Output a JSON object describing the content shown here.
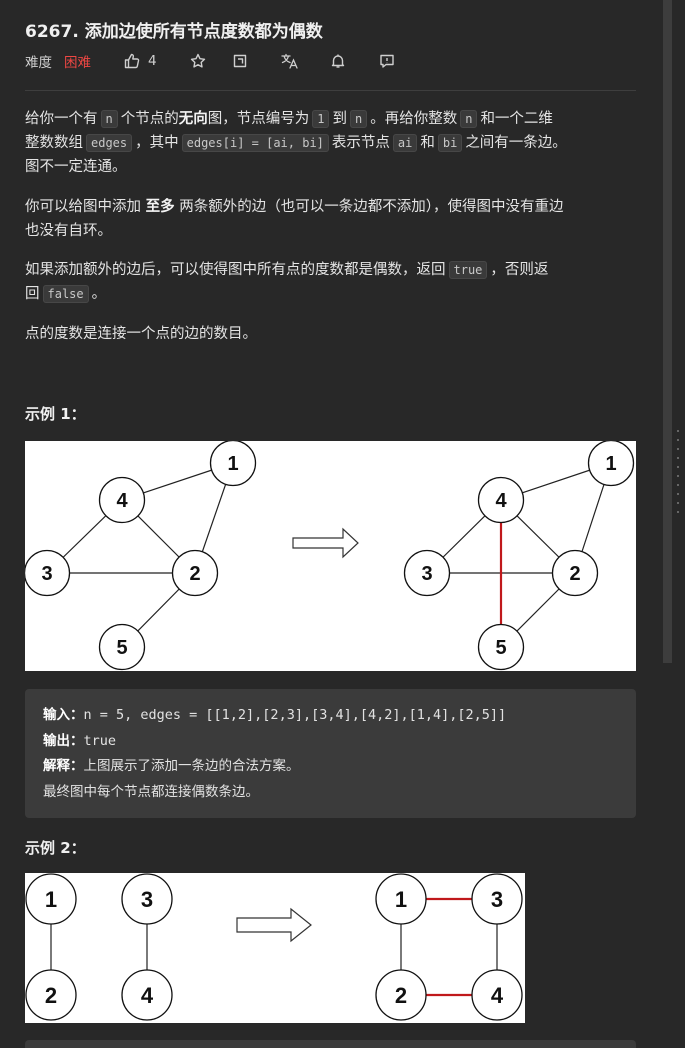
{
  "problem": {
    "title": "6267. 添加边使所有节点度数都为偶数",
    "difficulty_label": "难度",
    "difficulty": "困难",
    "likes": "4",
    "icons": [
      "thumb-up-icon",
      "star-icon",
      "share-icon",
      "translate-icon",
      "bell-icon",
      "feedback-icon"
    ]
  },
  "description": {
    "p1": {
      "t1": "给你一个有",
      "n1": "n",
      "t2": "个节点的",
      "b1": "无向",
      "t3": "图，节点编号为",
      "c1": "1",
      "t4": "到",
      "n2": "n",
      "t5": "。再给你整数",
      "n3": "n",
      "t6": "和一个二维",
      "t7": "整数数组",
      "c2": "edges",
      "t8": "，其中",
      "c3": "edges[i] = [ai, bi]",
      "t9": "表示节点",
      "c4": "ai",
      "t10": "和",
      "c5": "bi",
      "t11": "之间有一条边。",
      "t12": "图不一定连通。"
    },
    "p2": {
      "t1": "你可以给图中添加",
      "b1": "至多",
      "t2": "两条额外的边（也可以一条边都不添加），使得图中没有重边",
      "t3": "也没有自环。"
    },
    "p3": {
      "t1": "如果添加额外的边后，可以使得图中所有点的度数都是偶数，返回",
      "c1": "true",
      "t2": "，否则返",
      "t3": "回",
      "c2": "false",
      "t4": "。"
    },
    "p4": "点的度数是连接一个点的边的数目。"
  },
  "example1": {
    "heading": "示例 1：",
    "input_label": "输入：",
    "input": "n = 5, edges = [[1,2],[2,3],[3,4],[4,2],[1,4],[2,5]]",
    "output_label": "输出：",
    "output": "true",
    "explain_label": "解释：",
    "explain1": "上图展示了添加一条边的合法方案。",
    "explain2": "最终图中每个节点都连接偶数条边。",
    "node_labels": [
      "1",
      "2",
      "3",
      "4",
      "5"
    ]
  },
  "example2": {
    "heading": "示例 2：",
    "node_labels": [
      "1",
      "2",
      "3",
      "4"
    ]
  },
  "colors": {
    "background": "#282828",
    "difficulty_hard": "#ef4743",
    "added_edge": "#c0181b"
  }
}
